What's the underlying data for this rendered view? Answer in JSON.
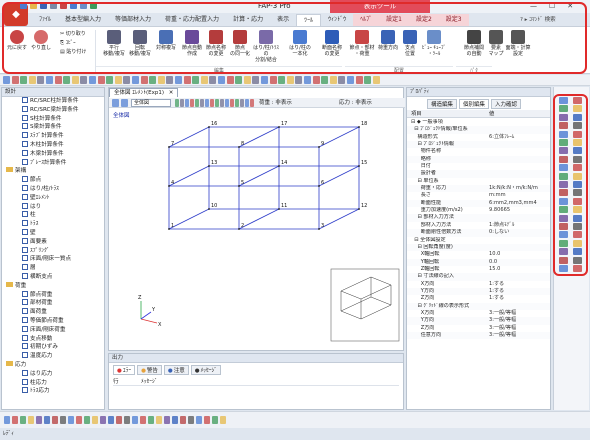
{
  "app": {
    "title": "FAP-3 Pro",
    "context_label": "表示ツール",
    "app_button_glyph": "◆",
    "window_controls": {
      "minimize": "—",
      "maximize": "☐",
      "close": "✕"
    }
  },
  "ribbon_tabs": [
    "ﾌｧｲﾙ",
    "基本型編入力",
    "等価部材入力",
    "荷重・応力配置入力",
    "計算・応力",
    "表示",
    "ﾂｰﾙ",
    "ｳｨﾝﾄﾞｳ",
    "ﾍﾙﾌﾟ",
    "設定1",
    "設定2",
    "設定3"
  ],
  "ribbon_help": "? ▸ ｺﾏﾝﾄﾞ 検索",
  "ribbon": {
    "undo_label": "元に戻す",
    "redo_label": "やり直し",
    "cut": "切り取り",
    "copy": "ｺﾋﾟｰ",
    "paste": "貼り付け",
    "buttons": [
      {
        "label": "平行\n移動/複写"
      },
      {
        "label": "回転\n移動/複写"
      },
      {
        "label": "対称複写"
      },
      {
        "label": "節点自動\n作成"
      },
      {
        "label": "節点名称\nの変更"
      },
      {
        "label": "節点\nの同一化"
      },
      {
        "label": "はり/柱/ﾄﾗｽの\n分割/結合"
      },
      {
        "label": "はり/柱の\n一本化"
      },
      {
        "label": "断面名称\nの変更"
      },
      {
        "label": "節点・部材\n・荷重"
      },
      {
        "label": "荷重方向"
      },
      {
        "label": "支点\n位置"
      },
      {
        "label": "ﾋﾞｭｰ ｷｭｰﾌﾞ\n・ﾂｰﾙ"
      },
      {
        "label": "節点補間\nの自動"
      },
      {
        "label": "要素\nマップ"
      },
      {
        "label": "面端・計算\n設定"
      }
    ],
    "groups": [
      "編集",
      "配置",
      "ﾊﾟﾀ"
    ]
  },
  "left_panel": {
    "title": "設計",
    "items": [
      {
        "label": "RC/SRC柱計算条件",
        "type": "check",
        "indent": 2
      },
      {
        "label": "RC/SRC梁計算条件",
        "type": "check",
        "indent": 2
      },
      {
        "label": "S柱計算条件",
        "type": "check",
        "indent": 2
      },
      {
        "label": "S梁計算条件",
        "type": "check",
        "indent": 2
      },
      {
        "label": "ｽﾗﾌﾞ計算条件",
        "type": "check",
        "indent": 2
      },
      {
        "label": "木柱計算条件",
        "type": "check",
        "indent": 2
      },
      {
        "label": "木梁計算条件",
        "type": "check",
        "indent": 2
      },
      {
        "label": "ﾌﾞﾚｰｽ計算条件",
        "type": "check",
        "indent": 2
      },
      {
        "label": "架構",
        "type": "folder",
        "indent": 0
      },
      {
        "label": "節点",
        "type": "check",
        "indent": 2
      },
      {
        "label": "はり/柱/ﾄﾗｽ",
        "type": "check",
        "indent": 2
      },
      {
        "label": "壁ｴﾚﾒﾝﾄ",
        "type": "check",
        "indent": 2
      },
      {
        "label": "はり",
        "type": "check",
        "indent": 2
      },
      {
        "label": "柱",
        "type": "check",
        "indent": 2
      },
      {
        "label": "ﾄﾗｽ",
        "type": "check",
        "indent": 2
      },
      {
        "label": "壁",
        "type": "check",
        "indent": 2
      },
      {
        "label": "面要素",
        "type": "check",
        "indent": 2
      },
      {
        "label": "ｽﾌﾟﾘﾝｸﾞ",
        "type": "check",
        "indent": 2
      },
      {
        "label": "床面/剛床一質点",
        "type": "check",
        "indent": 2
      },
      {
        "label": "層",
        "type": "check",
        "indent": 2
      },
      {
        "label": "横断支点",
        "type": "check",
        "indent": 2
      },
      {
        "label": "荷重",
        "type": "folder",
        "indent": 0
      },
      {
        "label": "節点荷重",
        "type": "check",
        "indent": 2
      },
      {
        "label": "部材荷重",
        "type": "check",
        "indent": 2
      },
      {
        "label": "面荷重",
        "type": "check",
        "indent": 2
      },
      {
        "label": "等価節点荷重",
        "type": "check",
        "indent": 2
      },
      {
        "label": "床面/剛床荷重",
        "type": "check",
        "indent": 2
      },
      {
        "label": "支点移動",
        "type": "check",
        "indent": 2
      },
      {
        "label": "初期ひずみ",
        "type": "check",
        "indent": 2
      },
      {
        "label": "温度応力",
        "type": "check",
        "indent": 2
      },
      {
        "label": "応力",
        "type": "folder",
        "indent": 0
      },
      {
        "label": "はり応力",
        "type": "check",
        "indent": 2
      },
      {
        "label": "柱応力",
        "type": "check",
        "indent": 2
      },
      {
        "label": "ﾄﾗｽ応力",
        "type": "check",
        "indent": 2
      }
    ]
  },
  "view": {
    "tab_label": "全体図 ｴﾚﾒﾝﾄ(Exp1)",
    "close_glyph": "✕",
    "combo_label": "全体図",
    "combo_value": "荷重 : 非表示",
    "stress_label": "応力 : 非表示",
    "caption": "全体図",
    "node_labels": [
      "1",
      "2",
      "3",
      "4",
      "5",
      "6",
      "7",
      "8",
      "9",
      "10",
      "11",
      "12",
      "13",
      "14",
      "15",
      "16",
      "17",
      "18"
    ],
    "axis_labels": {
      "x": "X",
      "y": "Y",
      "z": "Z"
    }
  },
  "output_panel": {
    "title": "出力",
    "tabs": [
      "ｴﾗｰ",
      "警告",
      "注意",
      "ﾒｯｾｰｼﾞ"
    ],
    "col_row": "行",
    "col_message": "ﾒｯｾｰｼﾞ"
  },
  "props_panel": {
    "title": "ﾌﾟﾛﾊﾟﾃｨ",
    "tabs": [
      "構造編集",
      "個別編集",
      "入力確認"
    ],
    "header_item": "項目",
    "header_value": "値",
    "rows": [
      {
        "k": "⊟ ◆ 一般事項",
        "v": ""
      },
      {
        "k": "  ⊟ ﾌﾟﾛｼﾞｪｸﾄ情報/単位系",
        "v": ""
      },
      {
        "k": "    構造形式",
        "v": "6:立体ﾌﾚｰﾑ"
      },
      {
        "k": "    ⊟ ﾌﾟﾛｼﾞｪｸﾄ情報",
        "v": ""
      },
      {
        "k": "      物件名称",
        "v": ""
      },
      {
        "k": "      略称",
        "v": ""
      },
      {
        "k": "      日付",
        "v": ""
      },
      {
        "k": "      設計者",
        "v": ""
      },
      {
        "k": "    ⊟ 単位系",
        "v": ""
      },
      {
        "k": "      荷重・応力",
        "v": "1k:N/k:N・m/k:N/m"
      },
      {
        "k": "      長さ",
        "v": "m:mm"
      },
      {
        "k": "      断面性能",
        "v": "6:mm2,mm3,mm4"
      },
      {
        "k": "      重力加速度(m/s2)",
        "v": "9.80665"
      },
      {
        "k": "    ⊟ 部材入力方法",
        "v": ""
      },
      {
        "k": "      部材入力方法",
        "v": "1:節点ﾓﾃﾞﾙ"
      },
      {
        "k": "      断面剛性倍数方法",
        "v": "0:しない"
      },
      {
        "k": "  ⊟ 全体図設定",
        "v": ""
      },
      {
        "k": "    ⊟ 回転角度(度)",
        "v": ""
      },
      {
        "k": "      X軸回転",
        "v": "10.0"
      },
      {
        "k": "      Y軸回転",
        "v": "0.0"
      },
      {
        "k": "      Z軸回転",
        "v": "15.0"
      },
      {
        "k": "    ⊟ 寸法線の記入",
        "v": ""
      },
      {
        "k": "      X方向",
        "v": "1:する"
      },
      {
        "k": "      Y方向",
        "v": "1:する"
      },
      {
        "k": "      Z方向",
        "v": "1:する"
      },
      {
        "k": "    ⊟ ｸﾞﾘｯﾄﾞ線の表示形式",
        "v": ""
      },
      {
        "k": "      X方向",
        "v": "3:一般/等幅"
      },
      {
        "k": "      Y方向",
        "v": "3:一般/等幅"
      },
      {
        "k": "      Z方向",
        "v": "3:一般/等幅"
      },
      {
        "k": "      任意方向",
        "v": "3:一般/等幅"
      }
    ]
  },
  "status": {
    "text": "ﾚﾃﾞｨ"
  },
  "colors": {
    "highlight": "#e02a2a",
    "accent_red": "#d23b2a",
    "panel_bg": "#ffffff",
    "frame_blue": "#2d3cc9"
  }
}
